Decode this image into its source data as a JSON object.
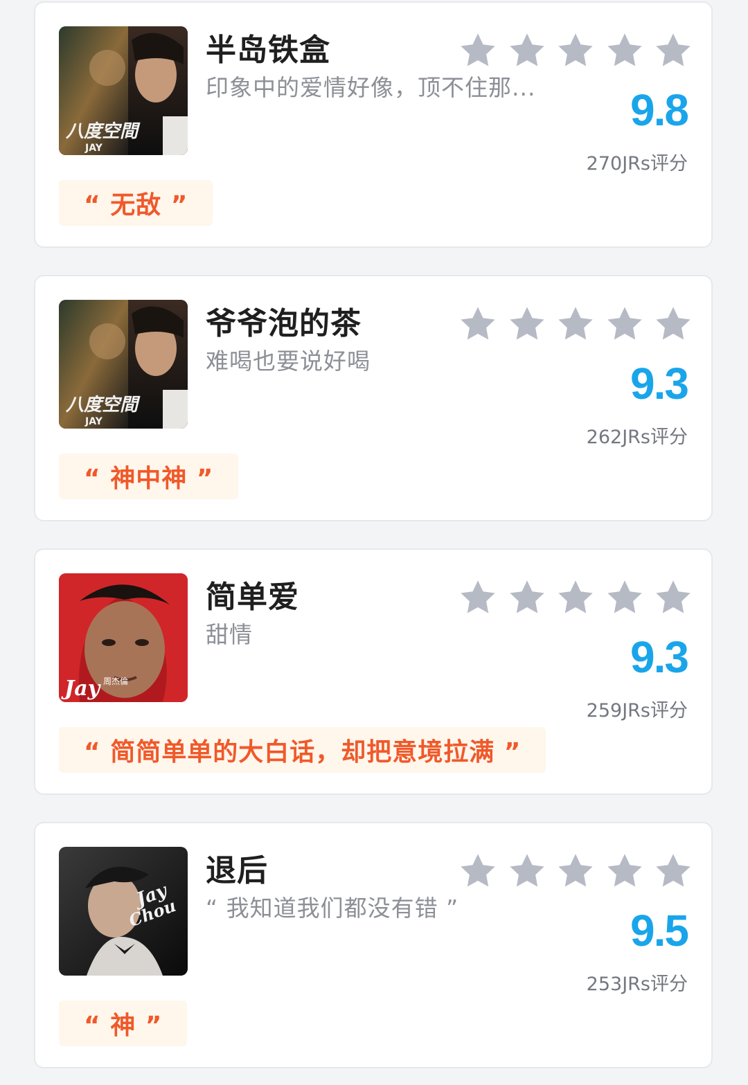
{
  "songs": [
    {
      "title": "半岛铁盒",
      "subtitle": "印象中的爱情好像，顶不住那...",
      "score": "9.8",
      "rating_count": "270JRs评分",
      "tag": "“ 无敌 ”",
      "cover": "album-cover-eight-dimensions"
    },
    {
      "title": "爷爷泡的茶",
      "subtitle": "难喝也要说好喝",
      "score": "9.3",
      "rating_count": "262JRs评分",
      "tag": "“ 神中神 ”",
      "cover": "album-cover-eight-dimensions"
    },
    {
      "title": "简单爱",
      "subtitle": "甜情",
      "score": "9.3",
      "rating_count": "259JRs评分",
      "tag": "“ 简简单单的大白话，却把意境拉满 ”",
      "cover": "album-cover-fantasy"
    },
    {
      "title": "退后",
      "subtitle": "“ 我知道我们都没有错 ”",
      "score": "9.5",
      "rating_count": "253JRs评分",
      "tag": "“ 神 ”",
      "cover": "album-cover-still-fantasy"
    }
  ],
  "colors": {
    "score": "#1aa5ea",
    "tag_text": "#f0592a",
    "tag_bg": "#fff6ec",
    "star": "#b6bac4"
  }
}
